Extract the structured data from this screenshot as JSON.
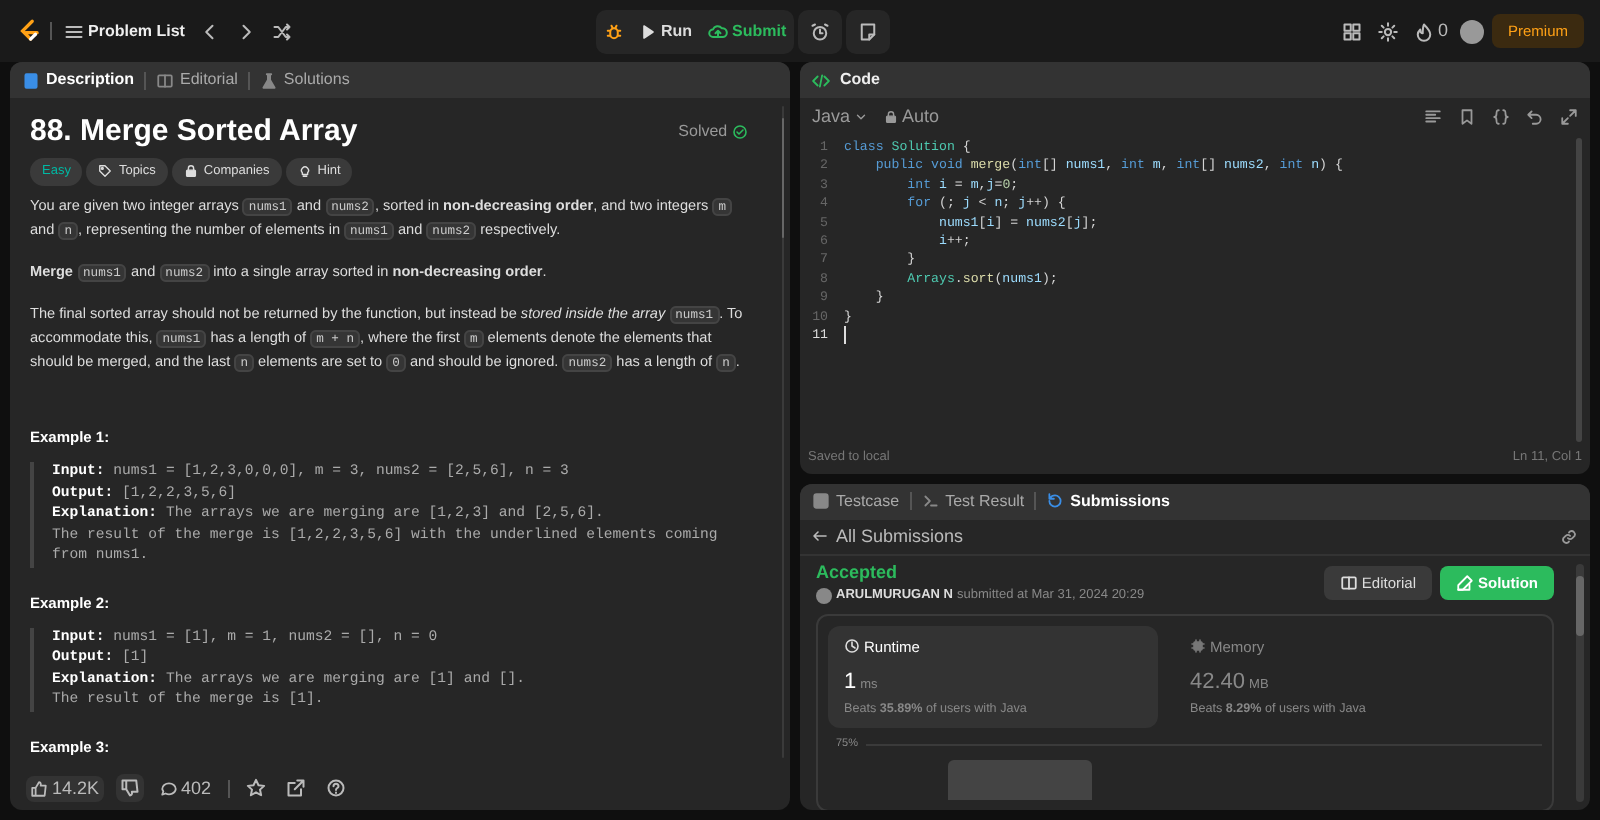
{
  "top_bar": {
    "nav_title": "Problem List",
    "run": "Run",
    "submit": "Submit",
    "streak": "0",
    "premium": "Premium"
  },
  "description_panel": {
    "tabs": [
      {
        "label": "Description",
        "selected": true
      },
      {
        "label": "Editorial",
        "selected": false
      },
      {
        "label": "Solutions",
        "selected": false
      }
    ],
    "title": "88. Merge Sorted Array",
    "status": "Solved",
    "tags": [
      {
        "label": "Easy",
        "kind": "difficulty"
      },
      {
        "label": "Topics",
        "kind": "topics"
      },
      {
        "label": "Companies",
        "kind": "companies"
      },
      {
        "label": "Hint",
        "kind": "hint"
      }
    ],
    "paragraphs": [
      [
        "You are given two integer arrays ",
        "nums1",
        " and ",
        "nums2",
        ", sorted in **non-decreasing order**, and two integers ",
        "m",
        " and ",
        "n",
        ", representing the number of elements in ",
        "nums1",
        " and ",
        "nums2",
        " respectively."
      ],
      [
        "**Merge** ",
        "nums1",
        " and ",
        "nums2",
        " into a single array sorted in **non-decreasing order**."
      ],
      [
        "The final sorted array should not be returned by the function, but instead be *stored inside the array* ",
        "nums1",
        ". To accommodate this, ",
        "nums1",
        " has a length of ",
        "m + n",
        ", where the first ",
        "m",
        " elements denote the elements that should be merged, and the last ",
        "n",
        " elements are set to ",
        "0",
        " and should be ignored. ",
        "nums2",
        " has a length of ",
        "n",
        "."
      ]
    ],
    "examples": [
      {
        "heading": "Example 1:",
        "lines": [
          {
            "label": "Input:",
            "text": "nums1 = [1,2,3,0,0,0], m = 3, nums2 = [2,5,6], n = 3"
          },
          {
            "label": "Output:",
            "text": "[1,2,2,3,5,6]"
          },
          {
            "label": "Explanation:",
            "text": "The arrays we are merging are [1,2,3] and [2,5,6]."
          },
          {
            "text": "The result of the merge is [1,2,2,3,5,6] with the underlined elements coming from nums1."
          }
        ]
      },
      {
        "heading": "Example 2:",
        "lines": [
          {
            "label": "Input:",
            "text": "nums1 = [1], m = 1, nums2 = [], n = 0"
          },
          {
            "label": "Output:",
            "text": "[1]"
          },
          {
            "label": "Explanation:",
            "text": "The arrays we are merging are [1] and []."
          },
          {
            "text": "The result of the merge is [1]."
          }
        ]
      },
      {
        "heading": "Example 3:"
      }
    ],
    "footer": {
      "likes": "14.2K",
      "comments": "402"
    }
  },
  "code_panel": {
    "title": "Code",
    "language": "Java",
    "mode": "Auto",
    "lines": [
      {
        "n": "1",
        "current": false,
        "tokens": [
          {
            "kind": "kw",
            "text": "class"
          },
          {
            "kind": "cls",
            "text": " Solution"
          },
          {
            "kind": "p",
            "text": " {"
          }
        ]
      },
      {
        "n": "2",
        "current": false,
        "tokens": [
          {
            "kind": "kw",
            "text": "    public void"
          },
          {
            "kind": "fn",
            "text": " merge"
          },
          {
            "kind": "p",
            "text": "("
          },
          {
            "kind": "kw",
            "text": "int"
          },
          {
            "kind": "p",
            "text": "[] "
          },
          {
            "kind": "var",
            "text": "nums1"
          },
          {
            "kind": "p",
            "text": ", "
          },
          {
            "kind": "kw",
            "text": "int"
          },
          {
            "kind": "var",
            "text": " m"
          },
          {
            "kind": "p",
            "text": ", "
          },
          {
            "kind": "kw",
            "text": "int"
          },
          {
            "kind": "p",
            "text": "[] "
          },
          {
            "kind": "var",
            "text": "nums2"
          },
          {
            "kind": "p",
            "text": ", "
          },
          {
            "kind": "kw",
            "text": "int"
          },
          {
            "kind": "var",
            "text": " n"
          },
          {
            "kind": "p",
            "text": ") {"
          }
        ]
      },
      {
        "n": "3",
        "current": false,
        "tokens": [
          {
            "kind": "kw",
            "text": "        int"
          },
          {
            "kind": "var",
            "text": " i"
          },
          {
            "kind": "p",
            "text": " = "
          },
          {
            "kind": "var",
            "text": "m"
          },
          {
            "kind": "p",
            "text": ","
          },
          {
            "kind": "var",
            "text": "j"
          },
          {
            "kind": "p",
            "text": "="
          },
          {
            "kind": "num",
            "text": "0"
          },
          {
            "kind": "p",
            "text": ";"
          }
        ]
      },
      {
        "n": "4",
        "current": false,
        "tokens": [
          {
            "kind": "kw",
            "text": "        for"
          },
          {
            "kind": "p",
            "text": " (; "
          },
          {
            "kind": "var",
            "text": "j"
          },
          {
            "kind": "p",
            "text": " < "
          },
          {
            "kind": "var",
            "text": "n"
          },
          {
            "kind": "p",
            "text": "; "
          },
          {
            "kind": "var",
            "text": "j"
          },
          {
            "kind": "p",
            "text": "++) {"
          }
        ]
      },
      {
        "n": "5",
        "current": false,
        "tokens": [
          {
            "kind": "var",
            "text": "            nums1"
          },
          {
            "kind": "p",
            "text": "["
          },
          {
            "kind": "var",
            "text": "i"
          },
          {
            "kind": "p",
            "text": "] = "
          },
          {
            "kind": "var",
            "text": "nums2"
          },
          {
            "kind": "p",
            "text": "["
          },
          {
            "kind": "var",
            "text": "j"
          },
          {
            "kind": "p",
            "text": "];"
          }
        ]
      },
      {
        "n": "6",
        "current": false,
        "tokens": [
          {
            "kind": "var",
            "text": "            i"
          },
          {
            "kind": "p",
            "text": "++;"
          }
        ]
      },
      {
        "n": "7",
        "current": false,
        "tokens": [
          {
            "kind": "p",
            "text": "        }"
          }
        ]
      },
      {
        "n": "8",
        "current": false,
        "tokens": [
          {
            "kind": "cls",
            "text": "        Arrays"
          },
          {
            "kind": "p",
            "text": "."
          },
          {
            "kind": "fn",
            "text": "sort"
          },
          {
            "kind": "p",
            "text": "("
          },
          {
            "kind": "var",
            "text": "nums1"
          },
          {
            "kind": "p",
            "text": ");"
          }
        ]
      },
      {
        "n": "9",
        "current": false,
        "tokens": [
          {
            "kind": "p",
            "text": "    }"
          }
        ]
      },
      {
        "n": "10",
        "current": false,
        "tokens": [
          {
            "kind": "p",
            "text": "}"
          }
        ]
      },
      {
        "n": "11",
        "current": true
      }
    ],
    "status": "Saved to local",
    "cursor": "Ln 11, Col 1"
  },
  "result_panel": {
    "tabs": [
      {
        "label": "Testcase",
        "selected": false
      },
      {
        "label": "Test Result",
        "selected": false
      },
      {
        "label": "Submissions",
        "selected": true
      }
    ],
    "back_label": "All Submissions",
    "verdict": "Accepted",
    "user": "ARULMURUGAN N",
    "submitted": "submitted at Mar 31, 2024 20:29",
    "buttons": [
      {
        "label": "Editorial",
        "kind": "secondary"
      },
      {
        "label": "Solution",
        "kind": "primary"
      }
    ],
    "stats": [
      {
        "kind": "runtime",
        "label": "Runtime",
        "selected": true,
        "value": "1",
        "unit": "ms",
        "beats": "Beats **35.89%** of users with Java"
      },
      {
        "kind": "memory",
        "label": "Memory",
        "selected": false,
        "value": "42.40",
        "unit": "MB",
        "beats": "Beats **8.29%** of users with Java"
      }
    ],
    "chart_label": "75%"
  }
}
